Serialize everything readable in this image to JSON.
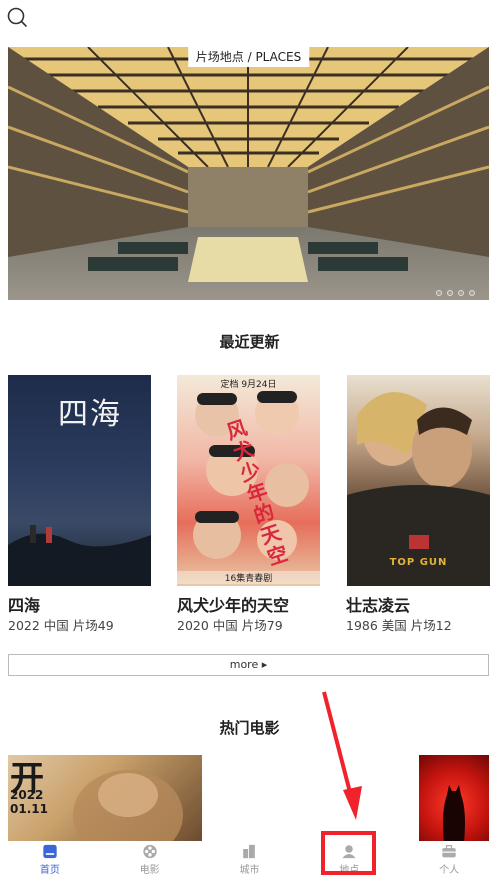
{
  "hero": {
    "caption": "片场地点 / PLACES",
    "dots": 4
  },
  "recent": {
    "title": "最近更新",
    "movies": [
      {
        "poster_text": "四海",
        "title": "四海",
        "meta": "2022 中国 片场49"
      },
      {
        "poster_text": "风犬少年的天空",
        "poster_top": "定档 9月24日",
        "poster_bottom": "16集青春剧",
        "title": "风犬少年的天空",
        "meta": "2020 中国 片场79"
      },
      {
        "poster_text": "TOP GUN",
        "title": "壮志凌云",
        "meta": "1986 美国 片场12"
      }
    ],
    "more_label": "more ▸"
  },
  "hot": {
    "title": "热门电影",
    "poster_text": "开",
    "poster_year": "2022",
    "poster_date": "01.11"
  },
  "tabbar": {
    "items": [
      {
        "label": "首页",
        "icon": "home-icon",
        "active": true
      },
      {
        "label": "电影",
        "icon": "film-reel-icon",
        "active": false
      },
      {
        "label": "城市",
        "icon": "city-icon",
        "active": false
      },
      {
        "label": "地点",
        "icon": "person-pin-icon",
        "active": false
      },
      {
        "label": "个人",
        "icon": "briefcase-icon",
        "active": false
      }
    ]
  },
  "colors": {
    "accent": "#3a66d8",
    "annotation": "#f0232d"
  }
}
